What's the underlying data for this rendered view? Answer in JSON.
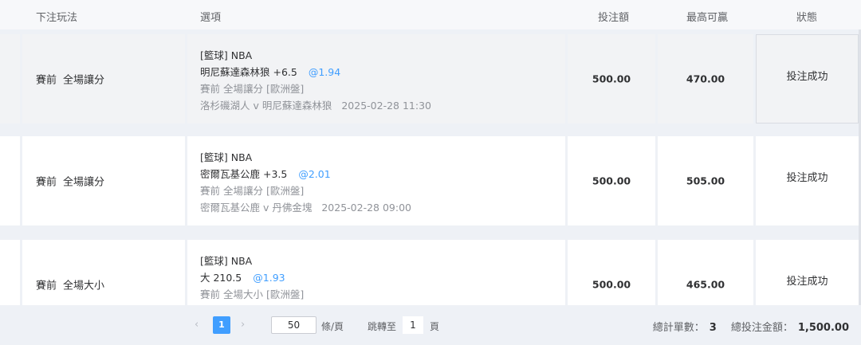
{
  "header": {
    "play_type": "下注玩法",
    "option": "選項",
    "stake": "投注額",
    "max_win": "最高可贏",
    "status": "狀態"
  },
  "rows": [
    {
      "play_phase": "賽前",
      "play_market": "全場讓分",
      "sport": "[籃球] NBA",
      "selection": "明尼蘇達森林狼 +6.5",
      "odds": "@1.94",
      "market_line": "賽前 全場讓分 [歐洲盤]",
      "match": "洛杉磯湖人 v 明尼蘇達森林狼",
      "time": "2025-02-28 11:30",
      "stake": "500.00",
      "max_win": "470.00",
      "status": "投注成功"
    },
    {
      "play_phase": "賽前",
      "play_market": "全場讓分",
      "sport": "[籃球] NBA",
      "selection": "密爾瓦基公鹿 +3.5",
      "odds": "@2.01",
      "market_line": "賽前 全場讓分 [歐洲盤]",
      "match": "密爾瓦基公鹿 v 丹佛金塊",
      "time": "2025-02-28 09:00",
      "stake": "500.00",
      "max_win": "505.00",
      "status": "投注成功"
    },
    {
      "play_phase": "賽前",
      "play_market": "全場大小",
      "sport": "[籃球] NBA",
      "selection": "大 210.5",
      "odds": "@1.93",
      "market_line": "賽前 全場大小 [歐洲盤]",
      "match": "",
      "time": "",
      "stake": "500.00",
      "max_win": "465.00",
      "status": "投注成功"
    }
  ],
  "pagination": {
    "prev": "‹",
    "next": "›",
    "current_page": "1",
    "page_size": "50",
    "page_size_unit": "條/頁",
    "jump_label": "跳轉至",
    "jump_value": "1",
    "jump_unit": "頁"
  },
  "summary": {
    "count_label": "總計單數：",
    "count_value": "3",
    "total_label": "總投注金額：",
    "total_value": "1,500.00"
  }
}
